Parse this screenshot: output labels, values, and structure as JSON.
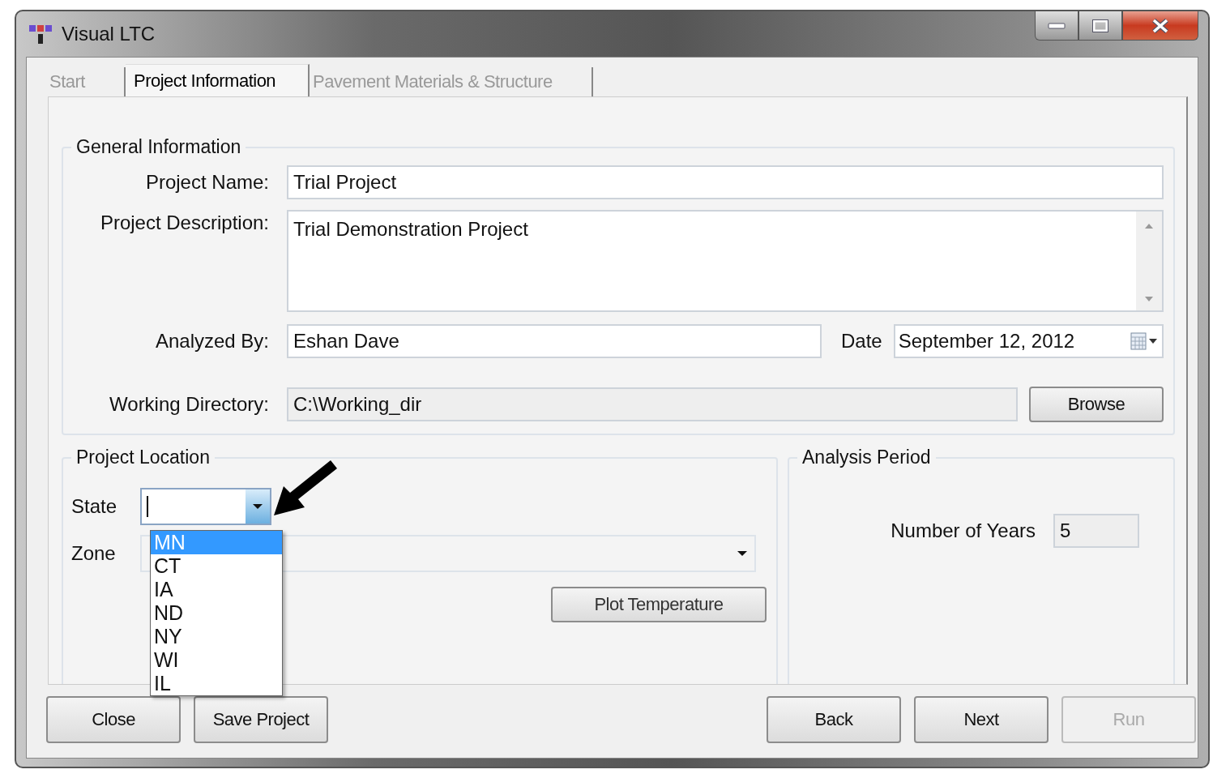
{
  "window": {
    "title": "Visual LTC"
  },
  "tabs": [
    {
      "label": "Start",
      "selected": false
    },
    {
      "label": "Project Information",
      "selected": true
    },
    {
      "label": "Pavement Materials & Structure",
      "selected": false
    }
  ],
  "general_information": {
    "title": "General Information",
    "project_name": {
      "label": "Project Name:",
      "value": "Trial Project"
    },
    "project_description": {
      "label": "Project Description:",
      "value": "Trial Demonstration Project"
    },
    "analyzed_by": {
      "label": "Analyzed By:",
      "value": "Eshan Dave"
    },
    "date": {
      "label": "Date",
      "value": "September 12, 2012"
    },
    "working_directory": {
      "label": "Working Directory:",
      "value": "C:\\Working_dir",
      "disabled": true
    },
    "browse_button": "Browse"
  },
  "project_location": {
    "title": "Project Location",
    "state": {
      "label": "State",
      "expanded": true,
      "options": [
        {
          "label": "MN",
          "selected": true
        },
        {
          "label": "CT",
          "selected": false
        },
        {
          "label": "IA",
          "selected": false
        },
        {
          "label": "ND",
          "selected": false
        },
        {
          "label": "NY",
          "selected": false
        },
        {
          "label": "WI",
          "selected": false
        },
        {
          "label": "IL",
          "selected": false
        }
      ]
    },
    "zone": {
      "label": "Zone"
    },
    "plot_button": "Plot Temperature"
  },
  "analysis_period": {
    "title": "Analysis Period",
    "years": {
      "label": "Number of Years",
      "value": "5"
    }
  },
  "left_buttons": [
    {
      "label": "Close",
      "disabled": false
    },
    {
      "label": "Save Project",
      "disabled": false
    }
  ],
  "right_buttons": [
    {
      "label": "Back",
      "disabled": false
    },
    {
      "label": "Next",
      "disabled": false
    },
    {
      "label": "Run",
      "disabled": true
    }
  ]
}
